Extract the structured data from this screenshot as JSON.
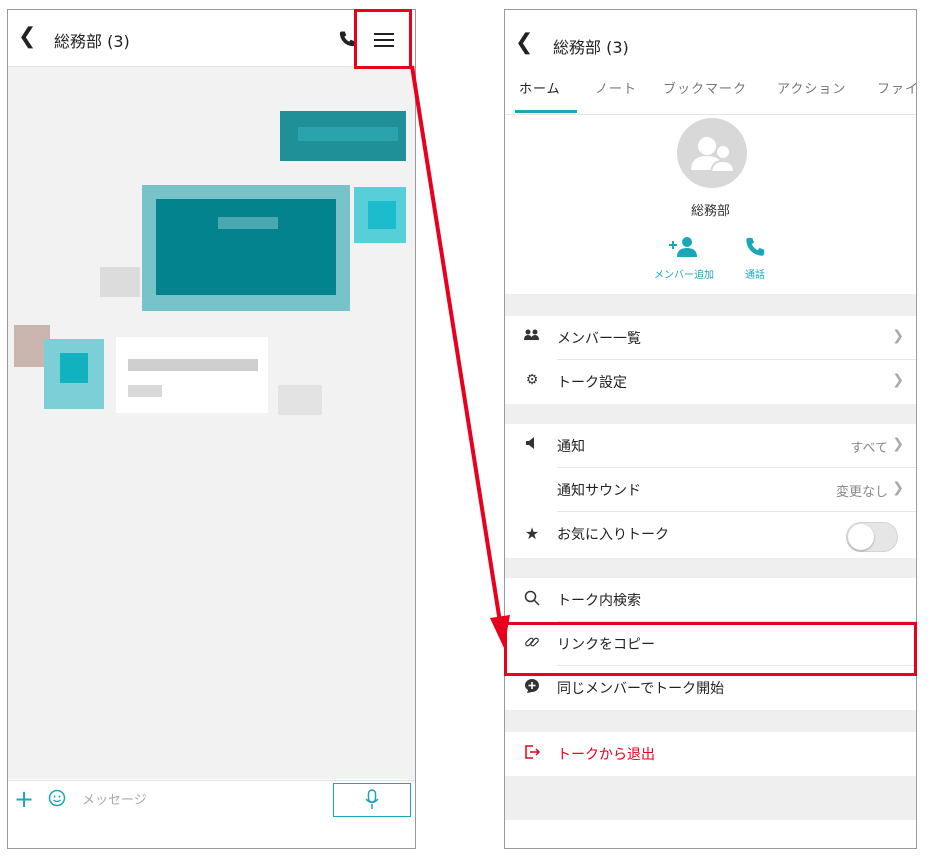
{
  "left_screen": {
    "header": {
      "back_icon": "chevron-left-icon",
      "title": "総務部 (3)",
      "call_icon": "phone-icon",
      "menu_icon": "hamburger-menu-icon"
    },
    "input_bar": {
      "placeholder": "メッセージ",
      "add_icon": "plus-icon",
      "emoji_icon": "smiley-icon",
      "mic_icon": "microphone-icon"
    }
  },
  "right_screen": {
    "header": {
      "back_icon": "chevron-left-icon",
      "title": "総務部 (3)"
    },
    "tabs": [
      {
        "label": "ホーム",
        "active": true
      },
      {
        "label": "ノート",
        "active": false
      },
      {
        "label": "ブックマーク",
        "active": false
      },
      {
        "label": "アクション",
        "active": false
      },
      {
        "label": "ファイ",
        "active": false
      }
    ],
    "profile": {
      "avatar_icon": "group-avatar-icon",
      "name": "総務部",
      "actions": [
        {
          "icon": "add-member-icon",
          "label": "メンバー追加"
        },
        {
          "icon": "phone-icon",
          "label": "通話"
        }
      ]
    },
    "menu": {
      "member_list": "メンバー一覧",
      "talk_settings": "トーク設定",
      "notifications": "通知",
      "notifications_value": "すべて",
      "notification_sound": "通知サウンド",
      "notification_sound_value": "変更なし",
      "favorite_talk": "お気に入りトーク",
      "favorite_talk_on": false,
      "search_in_talk": "トーク内検索",
      "copy_link": "リンクをコピー",
      "start_talk_same_members": "同じメンバーでトーク開始",
      "leave_talk": "トークから退出"
    }
  },
  "colors": {
    "accent": "#1aa7b8",
    "highlight": "#e8001c",
    "leave": "#e8001c"
  }
}
